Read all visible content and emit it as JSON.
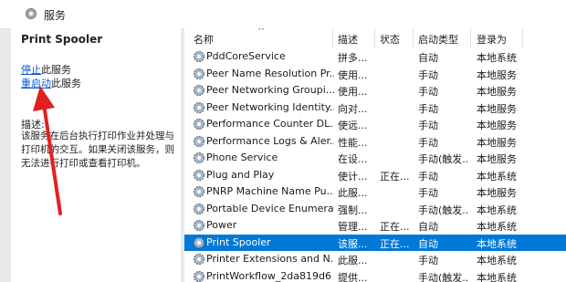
{
  "header": {
    "title": "服务"
  },
  "left": {
    "service_name": "Print Spooler",
    "stop_link": "停止",
    "stop_suffix": "此服务",
    "restart_link": "重启动",
    "restart_suffix": "此服务",
    "desc_label": "描述:",
    "description": "该服务在后台执行打印作业并处理与打印机的交互。如果关闭该服务，则无法进行打印或查看打印机。"
  },
  "columns": {
    "name": "名称",
    "desc": "描述",
    "state": "状态",
    "start": "启动类型",
    "logon": "登录为"
  },
  "rows": [
    {
      "name": "PddCoreService",
      "desc": "拼多...",
      "state": "",
      "start": "自动",
      "logon": "本地系统"
    },
    {
      "name": "Peer Name Resolution Pr...",
      "desc": "使用...",
      "state": "",
      "start": "手动",
      "logon": "本地服务"
    },
    {
      "name": "Peer Networking Groupi...",
      "desc": "使用...",
      "state": "",
      "start": "手动",
      "logon": "本地服务"
    },
    {
      "name": "Peer Networking Identity...",
      "desc": "向对...",
      "state": "",
      "start": "手动",
      "logon": "本地服务"
    },
    {
      "name": "Performance Counter DL...",
      "desc": "使远...",
      "state": "",
      "start": "手动",
      "logon": "本地服务"
    },
    {
      "name": "Performance Logs & Aler...",
      "desc": "性能...",
      "state": "",
      "start": "手动",
      "logon": "本地服务"
    },
    {
      "name": "Phone Service",
      "desc": "在设...",
      "state": "",
      "start": "手动(触发...",
      "logon": "本地服务"
    },
    {
      "name": "Plug and Play",
      "desc": "使计...",
      "state": "正在...",
      "start": "手动",
      "logon": "本地系统"
    },
    {
      "name": "PNRP Machine Name Pu...",
      "desc": "此服...",
      "state": "",
      "start": "手动",
      "logon": "本地服务"
    },
    {
      "name": "Portable Device Enumera...",
      "desc": "强制...",
      "state": "",
      "start": "手动(触发...",
      "logon": "本地系统"
    },
    {
      "name": "Power",
      "desc": "管理...",
      "state": "正在...",
      "start": "自动",
      "logon": "本地系统"
    },
    {
      "name": "Print Spooler",
      "desc": "该服...",
      "state": "正在...",
      "start": "自动",
      "logon": "本地系统"
    },
    {
      "name": "Printer Extensions and N...",
      "desc": "此服...",
      "state": "",
      "start": "手动",
      "logon": "本地系统"
    },
    {
      "name": "PrintWorkflow_2da819d6",
      "desc": "提供...",
      "state": "",
      "start": "手动(触发...",
      "logon": "本地系统"
    }
  ],
  "selected_row": 11,
  "colors": {
    "selection": "#0078d7",
    "link": "#0b57d0",
    "arrow": "#e32020"
  },
  "icons": {
    "header": "gear-icon",
    "row": "service-gear-icon"
  }
}
